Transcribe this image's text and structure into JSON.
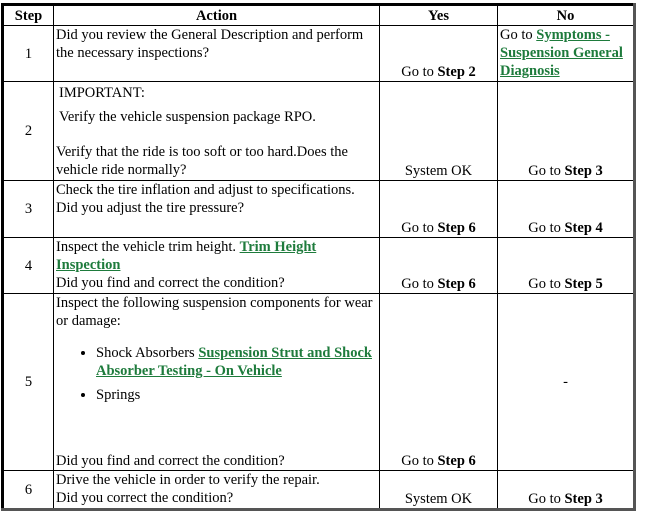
{
  "table": {
    "headers": {
      "step": "Step",
      "action": "Action",
      "yes": "Yes",
      "no": "No"
    },
    "link_color": "#1e7b3c",
    "rows": [
      {
        "step": "1",
        "action": "Did you review the General Description and perform the necessary inspections?",
        "yes_prefix": "Go to ",
        "yes_step": "Step 2",
        "no_prefix": "Go to ",
        "no_link": "Symptoms - Suspension General Diagnosis"
      },
      {
        "step": "2",
        "important_label": "IMPORTANT:",
        "important_text": "Verify the vehicle suspension package RPO.",
        "action": "Verify that the ride is too soft or too hard.Does the vehicle ride normally?",
        "yes": "System OK",
        "no_prefix": "Go to ",
        "no_step": "Step 3"
      },
      {
        "step": "3",
        "action_line1": "Check the tire inflation and adjust to specifications.",
        "action_line2": "Did you adjust the tire pressure?",
        "yes_prefix": "Go to ",
        "yes_step": "Step 6",
        "no_prefix": "Go to ",
        "no_step": "Step 4"
      },
      {
        "step": "4",
        "action_prefix": "Inspect the vehicle trim height. ",
        "action_link": "Trim Height Inspection",
        "action_question": "Did you find and correct the condition?",
        "yes_prefix": "Go to ",
        "yes_step": "Step 6",
        "no_prefix": "Go to ",
        "no_step": "Step 5"
      },
      {
        "step": "5",
        "action_intro": "Inspect the following suspension components for wear or damage:",
        "components": [
          {
            "label": "Shock Absorbers ",
            "link": "Suspension Strut and Shock Absorber Testing - On Vehicle"
          },
          {
            "label": "Springs"
          }
        ],
        "action_question": "Did you find and correct the condition?",
        "yes_prefix": "Go to ",
        "yes_step": "Step 6",
        "no": "-"
      },
      {
        "step": "6",
        "action_line1": "Drive the vehicle in order to verify the repair.",
        "action_line2": "Did you correct the condition?",
        "yes": "System OK",
        "no_prefix": "Go to ",
        "no_step": "Step 3"
      }
    ]
  }
}
